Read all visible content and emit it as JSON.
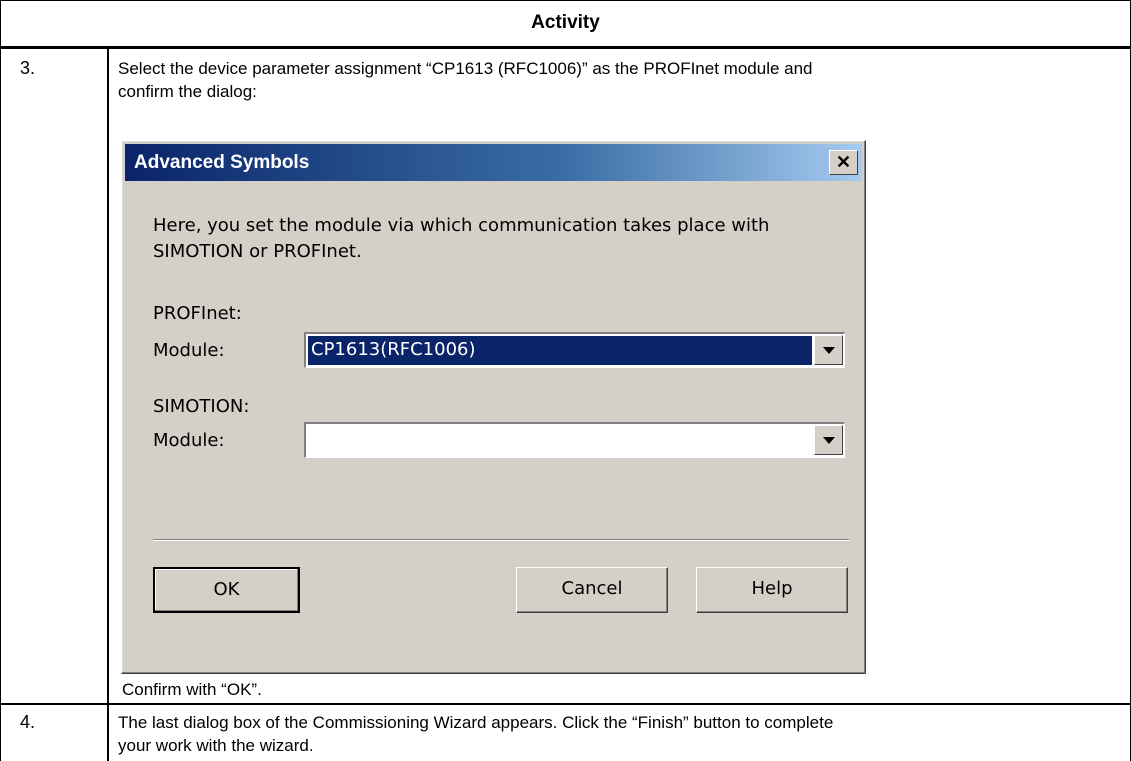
{
  "table": {
    "header": "Activity",
    "steps": [
      {
        "number": "3.",
        "instruction_line1": "Select the device parameter assignment “CP1613 (RFC1006)” as the PROFInet module and",
        "instruction_line2": "confirm the dialog:",
        "after_note": "Confirm with “OK”."
      },
      {
        "number": "4.",
        "instruction_line1": "The last dialog box of the Commissioning Wizard appears. Click the “Finish” button to complete",
        "instruction_line2": "your work with the wizard."
      }
    ]
  },
  "dialog": {
    "title": "Advanced Symbols",
    "close_glyph": "✕",
    "intro_line1": "Here, you set the module via which communication takes place with",
    "intro_line2": "SIMOTION or PROFInet.",
    "profinet_label": "PROFInet:",
    "profinet_module_label": "Module:",
    "profinet_module_value": "CP1613(RFC1006)",
    "simotion_label": "SIMOTION:",
    "simotion_module_label": "Module:",
    "simotion_module_value": "",
    "ok_label": "OK",
    "cancel_label": "Cancel",
    "help_label": "Help"
  }
}
